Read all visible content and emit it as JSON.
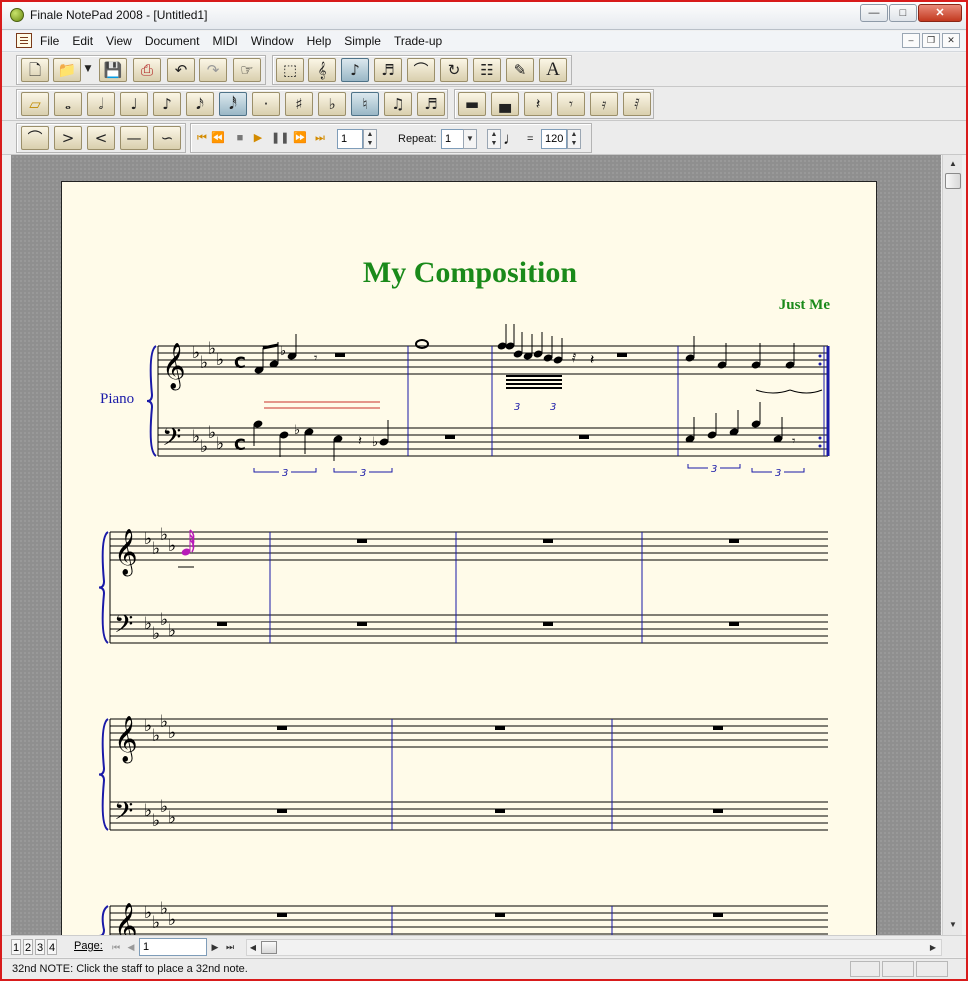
{
  "window": {
    "title": "Finale NotePad 2008 - [Untitled1]"
  },
  "menu": {
    "items": [
      "File",
      "Edit",
      "View",
      "Document",
      "MIDI",
      "Window",
      "Help",
      "Simple",
      "Trade-up"
    ]
  },
  "toolbars": {
    "file_tools": [
      "new-icon",
      "open-icon",
      "dropdown-arrow-icon",
      "save-icon",
      "print-icon",
      "undo-icon",
      "redo-icon",
      "hand-grabber-icon"
    ],
    "main_tools": [
      "selection-tool-icon",
      "staff-tool-icon",
      "simple-entry-tool-icon",
      "tuplet-tool-icon",
      "smart-shape-tool-icon",
      "repeat-tool-icon",
      "measure-tool-icon",
      "lyrics-tool-icon",
      "text-tool-icon"
    ],
    "text_tool_label": "A",
    "entry_tools": [
      "eraser-icon",
      "whole-note-icon",
      "half-note-icon",
      "quarter-note-icon",
      "eighth-note-icon",
      "sixteenth-note-icon",
      "thirty-second-note-icon",
      "dot-icon",
      "sharp-icon",
      "flat-icon",
      "natural-icon",
      "tie-icon",
      "tuplet-icon"
    ],
    "rest_tools": [
      "whole-rest-icon",
      "half-rest-icon",
      "quarter-rest-icon",
      "eighth-rest-icon",
      "sixteenth-rest-icon",
      "thirty-second-rest-icon"
    ],
    "smart_shapes": [
      "slur-icon",
      "decrescendo-icon",
      "crescendo-icon",
      "line-icon",
      "bend-line-icon"
    ],
    "playback": {
      "controls": [
        "go-to-start-icon",
        "rewind-icon",
        "stop-icon",
        "play-icon",
        "pause-icon",
        "fast-forward-icon",
        "go-to-end-icon"
      ],
      "start_measure": "1",
      "repeat_label": "Repeat:",
      "repeat_value": "1",
      "tempo_symbol": "♩",
      "tempo_equals": "=",
      "tempo_value": "120"
    }
  },
  "score": {
    "title": "My Composition",
    "composer": "Just Me",
    "instrument": "Piano",
    "key_signature": "A-flat major (4 flats)",
    "time_signature": "C",
    "tuplet_number": "3"
  },
  "bottom": {
    "page_tabs": [
      "1",
      "2",
      "3",
      "4"
    ],
    "page_label": "Page:",
    "page_value": "1"
  },
  "status": {
    "text": "32nd NOTE: Click the staff to place a 32nd note."
  },
  "colors": {
    "title_green": "#1a8a1a",
    "barline_blue": "#1a1aa8",
    "selected_note_magenta": "#b81bb8",
    "window_border_red": "#d81b1b"
  }
}
